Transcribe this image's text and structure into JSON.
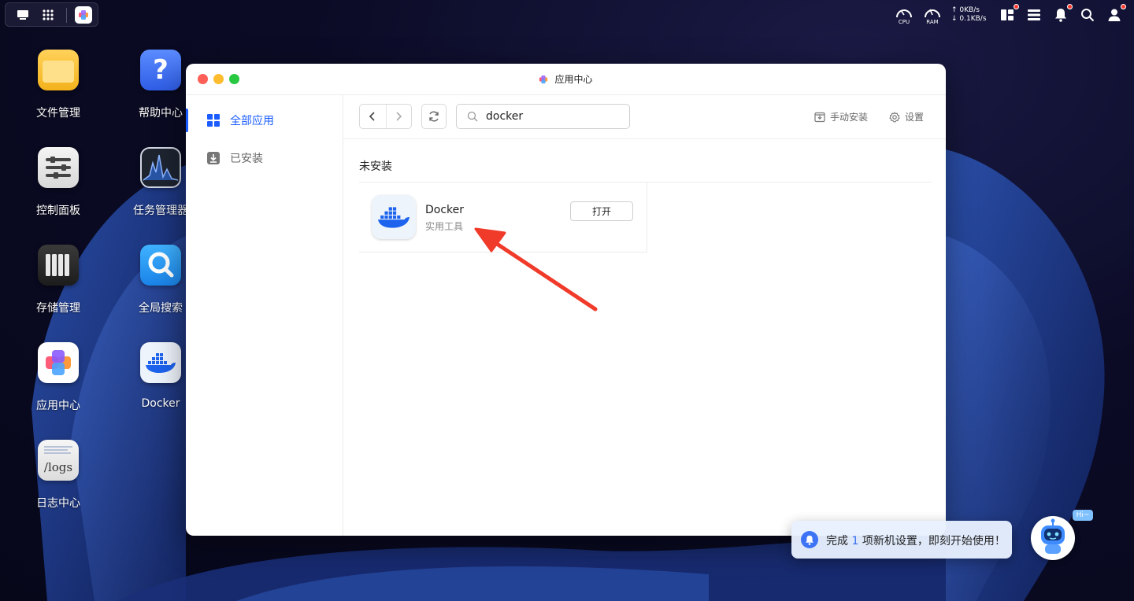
{
  "topbar": {
    "cpu_label": "CPU",
    "ram_label": "RAM",
    "net_up": "0KB/s",
    "net_down": "0.1KB/s"
  },
  "desktop": {
    "icons": [
      {
        "label": "文件管理"
      },
      {
        "label": "帮助中心"
      },
      {
        "label": "控制面板"
      },
      {
        "label": "任务管理器"
      },
      {
        "label": "存储管理"
      },
      {
        "label": "全局搜索"
      },
      {
        "label": "应用中心"
      },
      {
        "label": "Docker"
      },
      {
        "label": "日志中心",
        "icon_text": "/logs"
      }
    ]
  },
  "window": {
    "title": "应用中心",
    "sidebar": {
      "items": [
        {
          "label": "全部应用",
          "icon": "grid-icon",
          "active": true
        },
        {
          "label": "已安装",
          "icon": "download-icon",
          "active": false
        }
      ]
    },
    "toolbar": {
      "search_value": "docker",
      "manual_install": "手动安装",
      "settings": "设置"
    },
    "section_title": "未安装",
    "apps": [
      {
        "name": "Docker",
        "category": "实用工具",
        "button": "打开",
        "icon": "docker-whale-icon"
      }
    ]
  },
  "notification": {
    "prefix": "完成",
    "count": "1",
    "suffix": "项新机设置，即刻开始使用！"
  },
  "assistant": {
    "badge": "Hi~"
  },
  "colors": {
    "accent": "#1a5cff",
    "annotation_arrow": "#f03a2a",
    "traffic_red": "#fe5f57",
    "traffic_yellow": "#febc2e",
    "traffic_green": "#28c840"
  }
}
